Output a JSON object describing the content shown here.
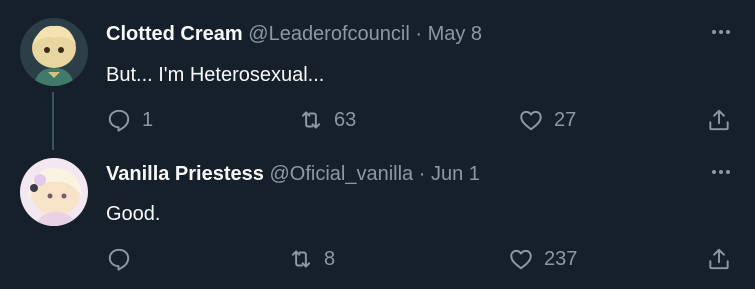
{
  "tweets": [
    {
      "name": "Clotted Cream",
      "handle": "@Leaderofcouncil",
      "separator": "·",
      "date": "May 8",
      "text": "But... I'm Heterosexual...",
      "replies": "1",
      "retweets": "63",
      "likes": "27"
    },
    {
      "name": "Vanilla Priestess",
      "handle": "@Oficial_vanilla",
      "separator": "·",
      "date": "Jun 1",
      "text": "Good.",
      "replies": "",
      "retweets": "8",
      "likes": "237"
    }
  ],
  "colors": {
    "background": "#15202b",
    "text": "#f7f9f9",
    "muted": "#8b98a5",
    "thread_line": "#3d5466"
  },
  "icons": [
    "reply-icon",
    "retweet-icon",
    "like-icon",
    "share-icon",
    "more-icon"
  ]
}
